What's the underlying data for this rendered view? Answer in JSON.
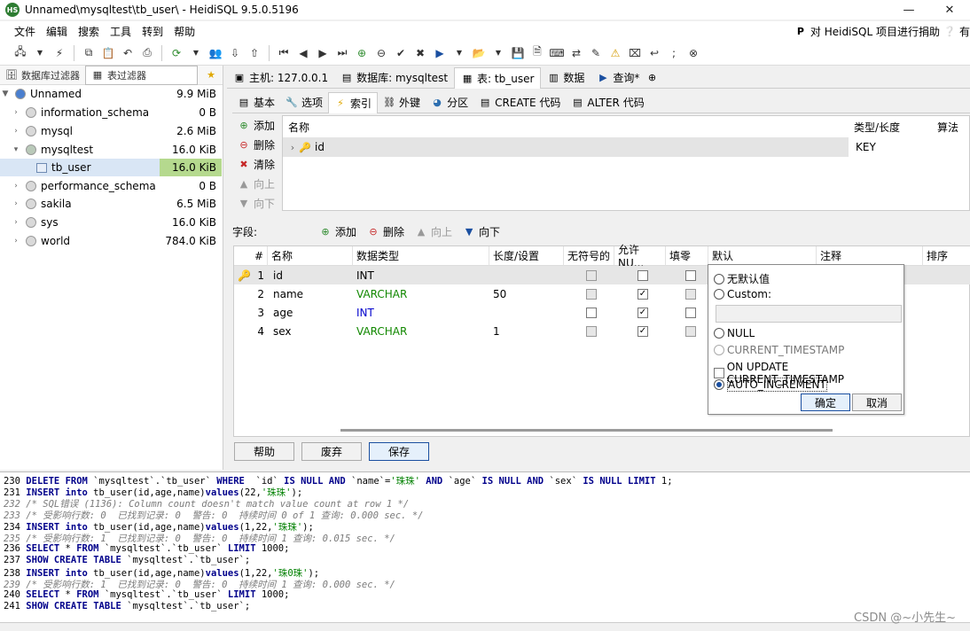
{
  "window": {
    "title": "Unnamed\\mysqltest\\tb_user\\ - HeidiSQL 9.5.0.5196",
    "minimize": "—",
    "close": "✕"
  },
  "menu": {
    "items": [
      "文件",
      "编辑",
      "搜索",
      "工具",
      "转到",
      "帮助"
    ],
    "donate": "对 HeidiSQL 项目进行捐助",
    "help_cut": "有"
  },
  "sidebar": {
    "filter_tabs": [
      "数据库过滤器",
      "表过滤器"
    ],
    "items": [
      {
        "name": "Unnamed",
        "size": "9.9 MiB"
      },
      {
        "name": "information_schema",
        "size": "0 B"
      },
      {
        "name": "mysql",
        "size": "2.6 MiB"
      },
      {
        "name": "mysqltest",
        "size": "16.0 KiB"
      },
      {
        "name": "tb_user",
        "size": "16.0 KiB"
      },
      {
        "name": "performance_schema",
        "size": "0 B"
      },
      {
        "name": "sakila",
        "size": "6.5 MiB"
      },
      {
        "name": "sys",
        "size": "16.0 KiB"
      },
      {
        "name": "world",
        "size": "784.0 KiB"
      }
    ]
  },
  "tabs": {
    "host": "主机: 127.0.0.1",
    "db": "数据库: mysqltest",
    "table": "表: tb_user",
    "data": "数据",
    "query": "查询*"
  },
  "subtabs": [
    "基本",
    "选项",
    "索引",
    "外键",
    "分区",
    "CREATE 代码",
    "ALTER 代码"
  ],
  "index": {
    "buttons": [
      "添加",
      "删除",
      "清除",
      "向上",
      "向下"
    ],
    "columns": [
      "名称",
      "类型/长度",
      "算法"
    ],
    "rows": [
      {
        "name": "id",
        "type": "KEY"
      }
    ]
  },
  "fields": {
    "label": "字段:",
    "buttons": [
      "添加",
      "删除",
      "向上",
      "向下"
    ],
    "columns": [
      "#",
      "名称",
      "数据类型",
      "长度/设置",
      "无符号的",
      "允许NU...",
      "填零",
      "默认",
      "注释",
      "排序"
    ],
    "rows": [
      {
        "num": "1",
        "name": "id",
        "type": "INT",
        "length": "",
        "unsigned": false,
        "nullable": false,
        "zerofill": false
      },
      {
        "num": "2",
        "name": "name",
        "type": "VARCHAR",
        "length": "50",
        "unsigned": false,
        "nullable": true,
        "zerofill": false
      },
      {
        "num": "3",
        "name": "age",
        "type": "INT",
        "length": "",
        "unsigned": false,
        "nullable": true,
        "zerofill": false
      },
      {
        "num": "4",
        "name": "sex",
        "type": "VARCHAR",
        "length": "1",
        "unsigned": false,
        "nullable": true,
        "zerofill": false
      }
    ]
  },
  "default_popup": {
    "options": [
      "无默认值",
      "Custom:",
      "NULL",
      "CURRENT_TIMESTAMP",
      "ON UPDATE CURRENT_TIMESTAMP",
      "AUTO_INCREMENT"
    ],
    "ok": "确定",
    "cancel": "取消"
  },
  "bottom_buttons": [
    "帮助",
    "废弃",
    "保存"
  ],
  "sql_log": [
    "230 DELETE FROM `mysqltest`.`tb_user` WHERE  `id` IS NULL AND `name`='珠珠' AND `age` IS NULL AND `sex` IS NULL LIMIT 1;",
    "231 INSERT into tb_user(id,age,name)values(22,'珠珠');",
    "232 /* SQL错误 (1136): Column count doesn't match value count at row 1 */",
    "233 /* 受影响行数: 0  已找到记录: 0  警告: 0  持续时间 0 of 1 查询: 0.000 sec. */",
    "234 INSERT into tb_user(id,age,name)values(1,22,'珠珠');",
    "235 /* 受影响行数: 1  已找到记录: 0  警告: 0  持续时间 1 查询: 0.015 sec. */",
    "236 SELECT * FROM `mysqltest`.`tb_user` LIMIT 1000;",
    "237 SHOW CREATE TABLE `mysqltest`.`tb_user`;",
    "238 INSERT into tb_user(id,age,name)values(1,22,'珠0珠');",
    "239 /* 受影响行数: 1  已找到记录: 0  警告: 0  持续时间 1 查询: 0.000 sec. */",
    "240 SELECT * FROM `mysqltest`.`tb_user` LIMIT 1000;",
    "241 SHOW CREATE TABLE `mysqltest`.`tb_user`;"
  ],
  "watermark": "CSDN @~小先生~"
}
